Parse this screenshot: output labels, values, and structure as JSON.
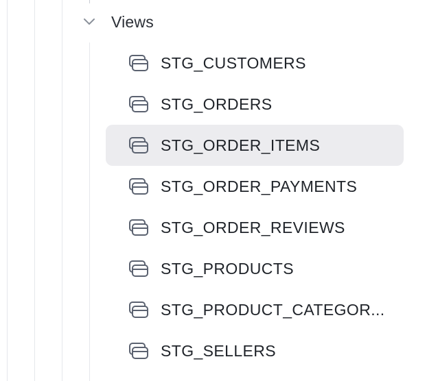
{
  "folder": {
    "label": "Views",
    "icon": "chevron-down-icon",
    "expanded": true
  },
  "views": [
    {
      "label": "STG_CUSTOMERS",
      "icon": "view-icon",
      "selected": false
    },
    {
      "label": "STG_ORDERS",
      "icon": "view-icon",
      "selected": false
    },
    {
      "label": "STG_ORDER_ITEMS",
      "icon": "view-icon",
      "selected": true
    },
    {
      "label": "STG_ORDER_PAYMENTS",
      "icon": "view-icon",
      "selected": false
    },
    {
      "label": "STG_ORDER_REVIEWS",
      "icon": "view-icon",
      "selected": false
    },
    {
      "label": "STG_PRODUCTS",
      "icon": "view-icon",
      "selected": false
    },
    {
      "label": "STG_PRODUCT_CATEGOR...",
      "icon": "view-icon",
      "selected": false
    },
    {
      "label": "STG_SELLERS",
      "icon": "view-icon",
      "selected": false
    }
  ],
  "colors": {
    "selected_row": "#ececef",
    "guide_line": "#e5e7eb",
    "icon": "#5b6270",
    "chevron": "#8a909a"
  }
}
